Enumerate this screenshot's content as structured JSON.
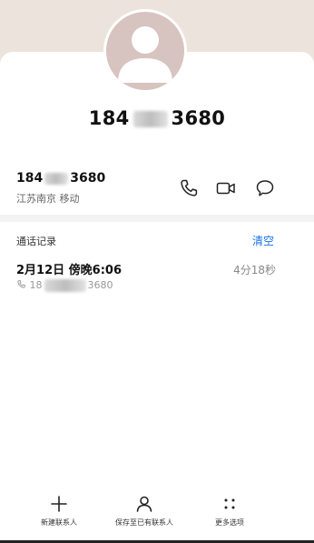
{
  "contact": {
    "name_prefix": "184",
    "name_suffix": "3680",
    "number_prefix": "184",
    "number_suffix": "3680",
    "location": "江苏南京 移动"
  },
  "actions": {
    "call_icon": "phone-icon",
    "video_icon": "video-icon",
    "message_icon": "message-icon"
  },
  "call_log": {
    "title": "通话记录",
    "clear_label": "清空",
    "entries": [
      {
        "date": "2月12日 傍晚6:06",
        "duration": "4分18秒",
        "number_prefix": "18",
        "number_suffix": "3680"
      }
    ]
  },
  "bottom_bar": {
    "new_contact": "新建联系人",
    "save_existing": "保存至已有联系人",
    "more_options": "更多选项"
  },
  "colors": {
    "header_bg": "#ece3dc",
    "avatar_bg": "#d7c3bf",
    "accent_blue": "#1a73e8"
  }
}
